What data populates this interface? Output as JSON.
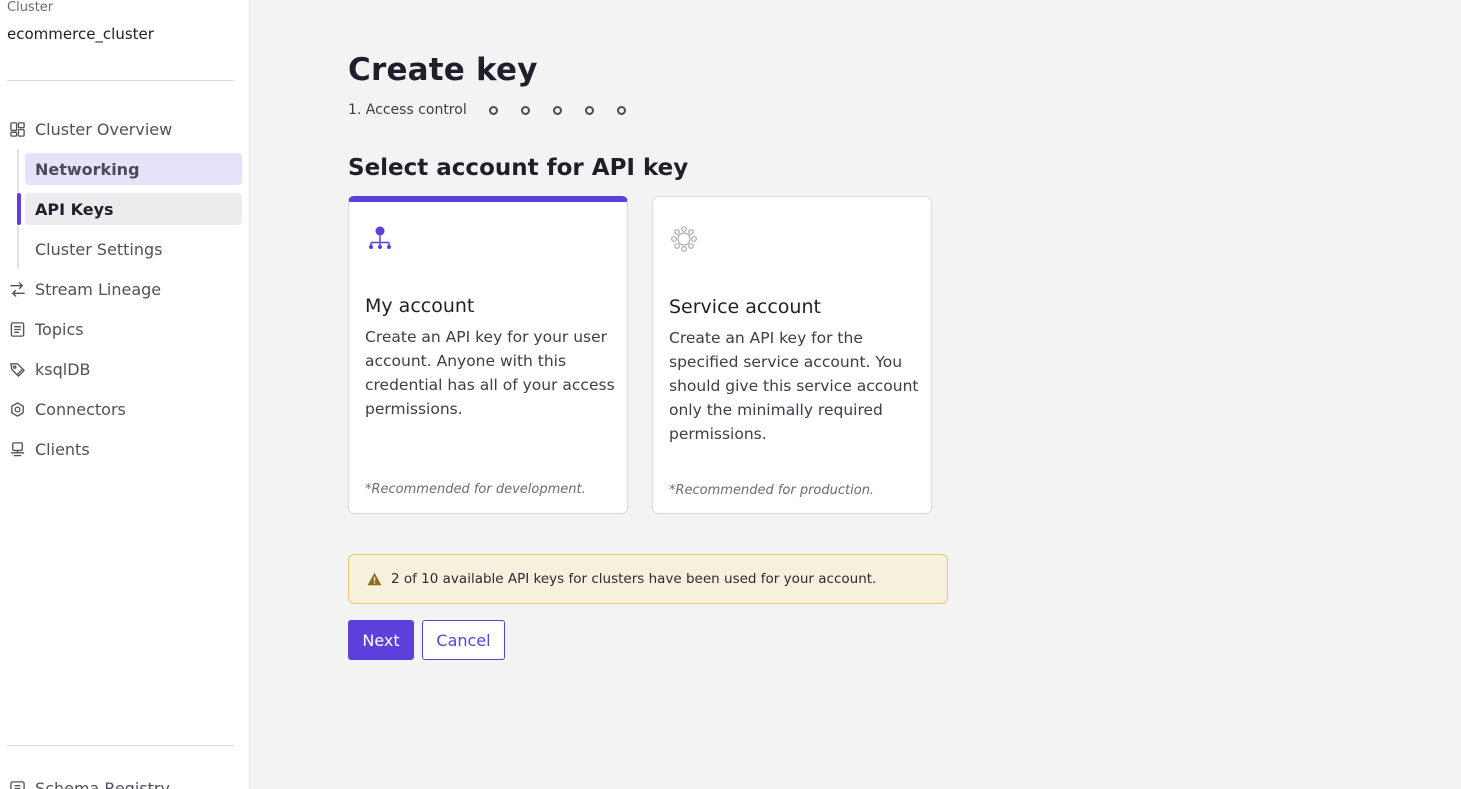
{
  "sidebar": {
    "caption": "Cluster",
    "cluster_name": "ecommerce_cluster",
    "items": [
      {
        "label": "Cluster Overview",
        "icon": "dashboard-icon"
      },
      {
        "label": "Stream Lineage",
        "icon": "lineage-icon"
      },
      {
        "label": "Topics",
        "icon": "topics-icon"
      },
      {
        "label": "ksqlDB",
        "icon": "ksqldb-icon"
      },
      {
        "label": "Connectors",
        "icon": "connectors-icon"
      },
      {
        "label": "Clients",
        "icon": "clients-icon"
      }
    ],
    "sub_items": [
      {
        "label": "Networking"
      },
      {
        "label": "API Keys"
      },
      {
        "label": "Cluster Settings"
      }
    ],
    "bottom_item": "Schema Registry"
  },
  "main": {
    "title": "Create key",
    "stepper": {
      "current_label": "1. Access control",
      "remaining_steps": 5
    },
    "section_title": "Select account for API key",
    "cards": [
      {
        "title": "My account",
        "description": "Create an API key for your user account. Anyone with this credential has all of your access permissions.",
        "note": "*Recommended for development.",
        "icon": "org-hierarchy-icon",
        "selected": true
      },
      {
        "title": "Service account",
        "description": "Create an API key for the specified service account. You should give this service account only the minimally required permissions.",
        "note": "*Recommended for production.",
        "icon": "service-account-icon",
        "selected": false
      }
    ],
    "warning": "2 of 10 available API keys for clusters have been used for your account.",
    "buttons": {
      "next": "Next",
      "cancel": "Cancel"
    }
  },
  "colors": {
    "accent": "#5e3fdb",
    "warning_bg": "#f7f0dc",
    "warning_border": "#e9c96b",
    "warning_icon": "#8a6d1e"
  }
}
